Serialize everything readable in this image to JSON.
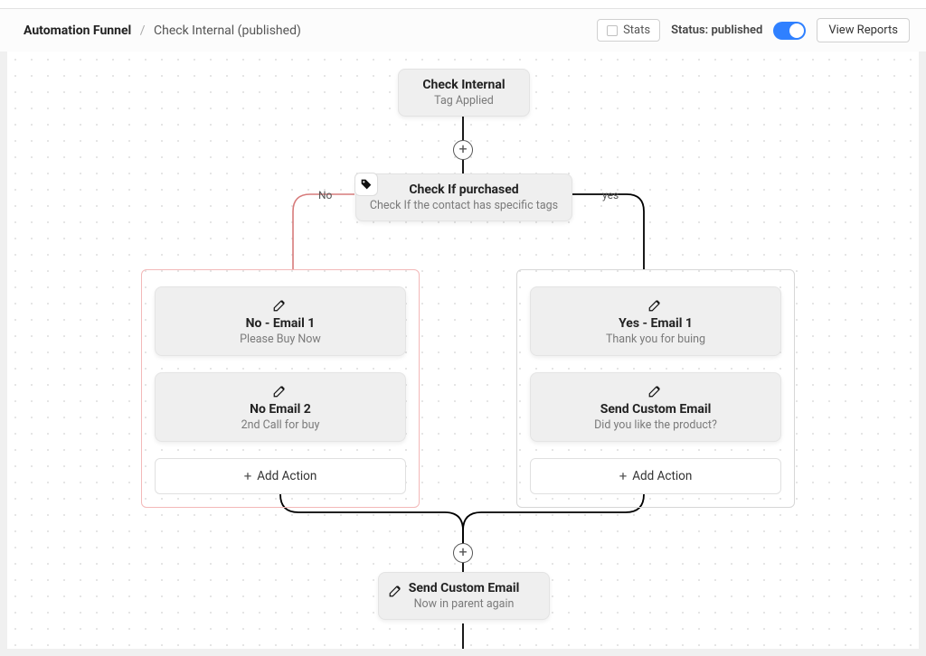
{
  "header": {
    "breadcrumb_root": "Automation Funnel",
    "breadcrumb_current": "Check Internal (published)",
    "stats_label": "Stats",
    "status_label": "Status: published",
    "status_on": true,
    "reports_label": "View Reports"
  },
  "nodes": {
    "start": {
      "title": "Check Internal",
      "sub": "Tag Applied"
    },
    "condition": {
      "title": "Check If purchased",
      "sub": "Check If the contact has specific tags"
    },
    "branch_no_label": "No",
    "branch_yes_label": "yes",
    "no_actions": [
      {
        "title": "No - Email 1",
        "sub": "Please Buy Now"
      },
      {
        "title": "No Email 2",
        "sub": "2nd Call for buy"
      }
    ],
    "yes_actions": [
      {
        "title": "Yes - Email 1",
        "sub": "Thank you for buing"
      },
      {
        "title": "Send Custom Email",
        "sub": "Did you like the product?"
      }
    ],
    "add_action_label": "Add Action",
    "after": {
      "title": "Send Custom Email",
      "sub": "Now in parent again"
    }
  },
  "icons": {
    "pencil": "pencil-icon",
    "tag": "tag-icon",
    "plus": "plus-icon"
  }
}
